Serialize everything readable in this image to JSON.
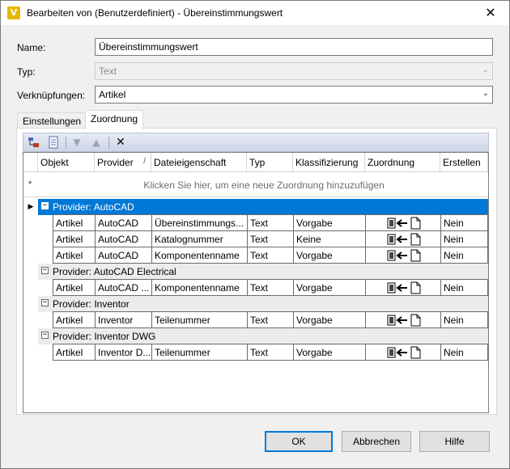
{
  "window": {
    "title": "Bearbeiten von (Benutzerdefiniert) - Übereinstimmungswert",
    "app_icon_letter": "V",
    "close_glyph": "✕"
  },
  "form": {
    "name_label": "Name:",
    "name_value": "Übereinstimmungswert",
    "type_label": "Typ:",
    "type_value": "Text",
    "link_label": "Verknüpfungen:",
    "link_value": "Artikel"
  },
  "tabs": [
    {
      "label": "Einstellungen",
      "active": false
    },
    {
      "label": "Zuordnung",
      "active": true
    }
  ],
  "toolbar": {
    "icons": [
      "add-mapping-icon",
      "import-icon",
      "move-down-icon",
      "move-up-icon",
      "delete-icon"
    ],
    "delete_glyph": "✕"
  },
  "grid": {
    "columns": [
      "Objekt",
      "Provider",
      "Dateieigenschaft",
      "Typ",
      "Klassifizierung",
      "Zuordnung",
      "Erstellen"
    ],
    "sort_indicator": "/",
    "new_row_star": "*",
    "new_row_hint": "Klicken Sie hier, um eine neue Zuordnung hinzuzufügen",
    "groups": [
      {
        "label": "Provider: AutoCAD",
        "selected": true,
        "expander": "−",
        "rows": [
          {
            "objekt": "Artikel",
            "provider": "AutoCAD",
            "dateieigenschaft": "Übereinstimmungs...",
            "typ": "Text",
            "klassifizierung": "Vorgabe",
            "erstellen": "Nein"
          },
          {
            "objekt": "Artikel",
            "provider": "AutoCAD",
            "dateieigenschaft": "Katalognummer",
            "typ": "Text",
            "klassifizierung": "Keine",
            "erstellen": "Nein"
          },
          {
            "objekt": "Artikel",
            "provider": "AutoCAD",
            "dateieigenschaft": "Komponentenname",
            "typ": "Text",
            "klassifizierung": "Vorgabe",
            "erstellen": "Nein"
          }
        ]
      },
      {
        "label": "Provider: AutoCAD Electrical",
        "selected": false,
        "expander": "−",
        "rows": [
          {
            "objekt": "Artikel",
            "provider": "AutoCAD ...",
            "dateieigenschaft": "Komponentenname",
            "typ": "Text",
            "klassifizierung": "Vorgabe",
            "erstellen": "Nein"
          }
        ]
      },
      {
        "label": "Provider: Inventor",
        "selected": false,
        "expander": "−",
        "rows": [
          {
            "objekt": "Artikel",
            "provider": "Inventor",
            "dateieigenschaft": "Teilenummer",
            "typ": "Text",
            "klassifizierung": "Vorgabe",
            "erstellen": "Nein"
          }
        ]
      },
      {
        "label": "Provider: Inventor DWG",
        "selected": false,
        "expander": "−",
        "rows": [
          {
            "objekt": "Artikel",
            "provider": "Inventor D...",
            "dateieigenschaft": "Teilenummer",
            "typ": "Text",
            "klassifizierung": "Vorgabe",
            "erstellen": "Nein"
          }
        ]
      }
    ]
  },
  "buttons": {
    "ok": "OK",
    "cancel": "Abbrechen",
    "help": "Hilfe"
  },
  "colors": {
    "selection": "#0078d7",
    "toolbar_top": "#e7ebf4",
    "toolbar_bottom": "#cdd5e6"
  }
}
